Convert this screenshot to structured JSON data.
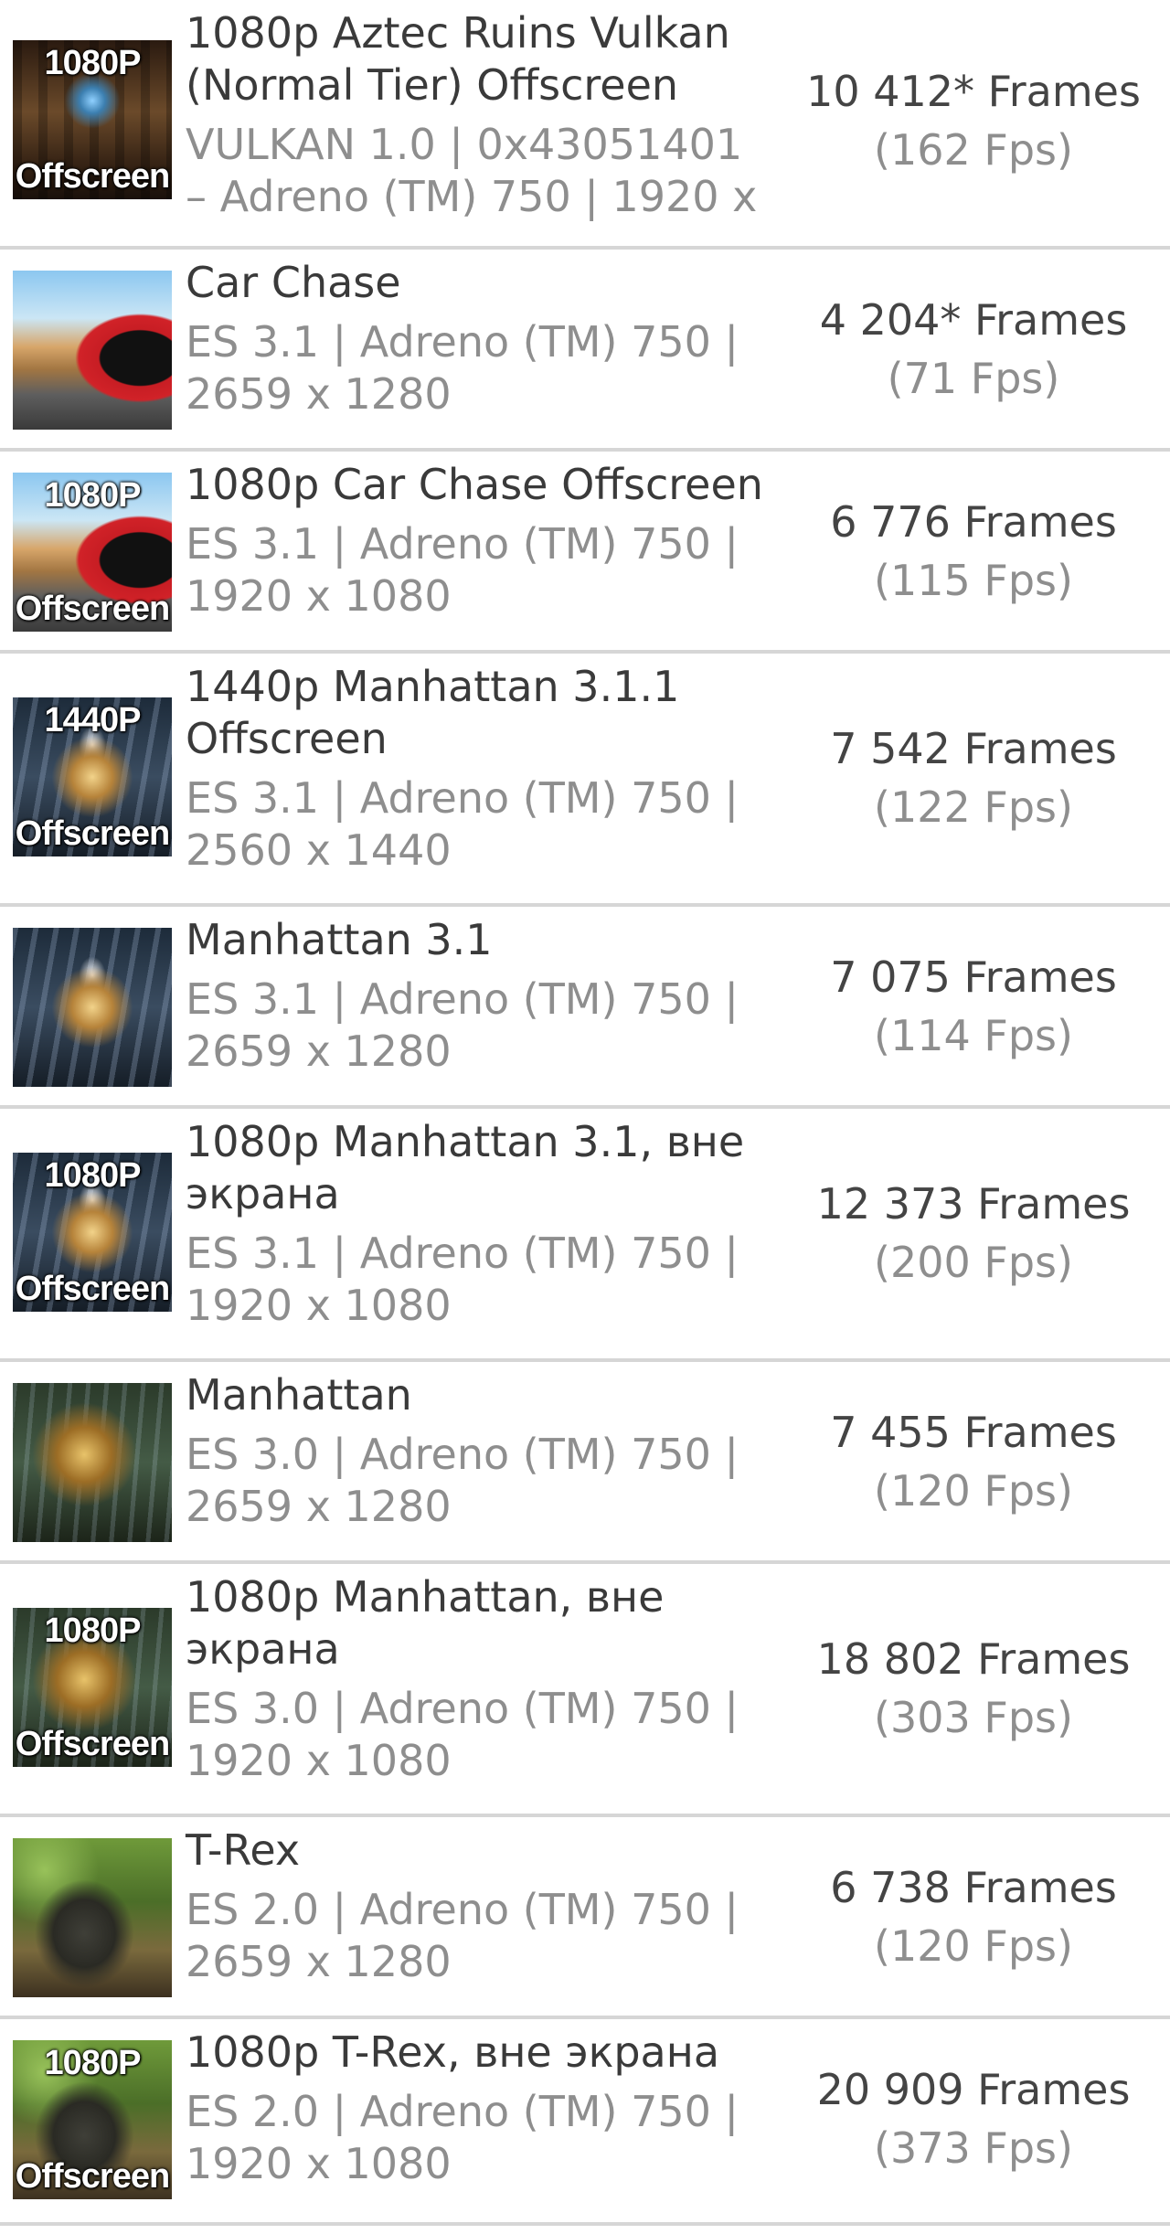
{
  "tests": [
    {
      "title": "1080p Aztec Ruins Vulkan\n(Normal Tier) Offscreen",
      "details": "VULKAN 1.0 | 0x43051401\n– Adreno (TM) 750 | 1920 x",
      "frames": "10 412* Frames",
      "fps": "(162 Fps)",
      "badge_top": "1080P",
      "badge_bottom": "Offscreen",
      "art": "art-aztec"
    },
    {
      "title": "Car Chase",
      "details": "ES 3.1 | Adreno (TM) 750 |\n2659 x 1280",
      "frames": "4 204* Frames",
      "fps": "(71 Fps)",
      "badge_top": "",
      "badge_bottom": "",
      "art": "art-car"
    },
    {
      "title": "1080p Car Chase Offscreen",
      "details": "ES 3.1 | Adreno (TM) 750 |\n1920 x 1080",
      "frames": "6 776 Frames",
      "fps": "(115 Fps)",
      "badge_top": "1080P",
      "badge_bottom": "Offscreen",
      "art": "art-car"
    },
    {
      "title": "1440p Manhattan 3.1.1\nOffscreen",
      "details": "ES 3.1 | Adreno (TM) 750 |\n2560 x 1440",
      "frames": "7 542 Frames",
      "fps": "(122 Fps)",
      "badge_top": "1440P",
      "badge_bottom": "Offscreen",
      "art": "art-manhattan"
    },
    {
      "title": "Manhattan 3.1",
      "details": "ES 3.1 | Adreno (TM) 750 |\n2659 x 1280",
      "frames": "7 075 Frames",
      "fps": "(114 Fps)",
      "badge_top": "",
      "badge_bottom": "",
      "art": "art-manhattan"
    },
    {
      "title": "1080p Manhattan 3.1, вне\nэкрана",
      "details": "ES 3.1 | Adreno (TM) 750 |\n1920 x 1080",
      "frames": "12 373 Frames",
      "fps": "(200 Fps)",
      "badge_top": "1080P",
      "badge_bottom": "Offscreen",
      "art": "art-manhattan"
    },
    {
      "title": "Manhattan",
      "details": "ES 3.0 | Adreno (TM) 750 |\n2659 x 1280",
      "frames": "7 455 Frames",
      "fps": "(120 Fps)",
      "badge_top": "",
      "badge_bottom": "",
      "art": "art-manhattan-gold"
    },
    {
      "title": "1080p Manhattan, вне\nэкрана",
      "details": "ES 3.0 | Adreno (TM) 750 |\n1920 x 1080",
      "frames": "18 802 Frames",
      "fps": "(303 Fps)",
      "badge_top": "1080P",
      "badge_bottom": "Offscreen",
      "art": "art-manhattan-gold"
    },
    {
      "title": "T-Rex",
      "details": "ES 2.0 | Adreno (TM) 750 |\n2659 x 1280",
      "frames": "6 738 Frames",
      "fps": "(120 Fps)",
      "badge_top": "",
      "badge_bottom": "",
      "art": "art-trex"
    },
    {
      "title": "1080p T-Rex, вне экрана",
      "details": "ES 2.0 | Adreno (TM) 750 |\n1920 x 1080",
      "frames": "20 909 Frames",
      "fps": "(373 Fps)",
      "badge_top": "1080P",
      "badge_bottom": "Offscreen",
      "art": "art-trex"
    }
  ]
}
